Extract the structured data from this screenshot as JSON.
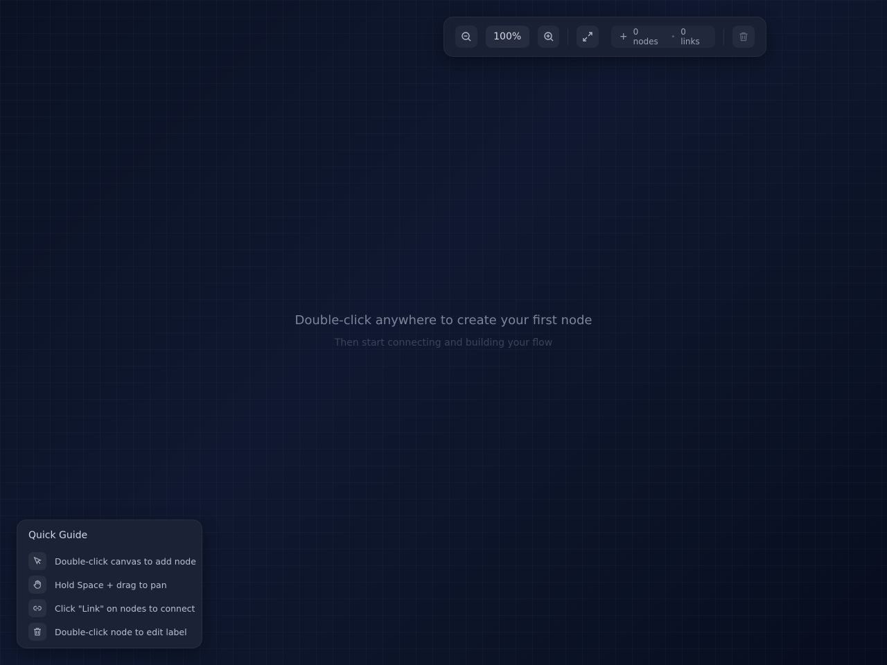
{
  "toolbar": {
    "zoom_level": "100%",
    "stats": {
      "nodes": "0 nodes",
      "separator": "•",
      "links": "0 links"
    },
    "icons": {
      "zoom_out": "zoom-out-icon",
      "zoom_in": "zoom-in-icon",
      "fit": "expand-icon",
      "add": "plus-icon",
      "delete": "trash-icon"
    }
  },
  "empty_state": {
    "title": "Double-click anywhere to create your first node",
    "subtitle": "Then start connecting and building your flow"
  },
  "guide": {
    "title": "Quick Guide",
    "items": [
      {
        "icon": "cursor-icon",
        "text": "Double-click canvas to add node"
      },
      {
        "icon": "hand-icon",
        "text": "Hold Space + drag to pan"
      },
      {
        "icon": "link-icon",
        "text": "Click \"Link\" on nodes to connect"
      },
      {
        "icon": "trash-icon",
        "text": "Double-click node to edit label"
      }
    ]
  },
  "colors": {
    "background": "#0f1830",
    "panel": "#1e2438",
    "text_primary": "#cfd5e2",
    "text_muted": "#7c8598"
  }
}
